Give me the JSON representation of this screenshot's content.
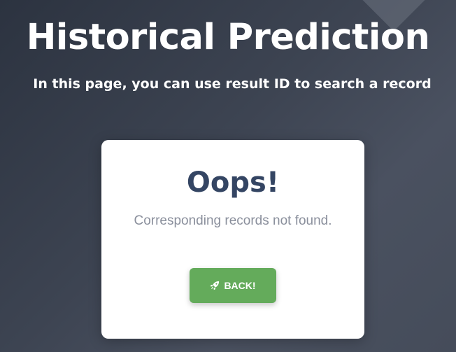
{
  "header": {
    "title": "Historical Prediction",
    "subtitle": "In this page, you can use result ID to search a record"
  },
  "card": {
    "title": "Oops!",
    "message": "Corresponding records not found.",
    "back_button": {
      "label": "BACK!",
      "icon": "rocket-icon"
    }
  },
  "colors": {
    "background": "#3d4452",
    "card_title": "#344563",
    "message": "#8a8f9c",
    "button": "#64ab5b"
  }
}
